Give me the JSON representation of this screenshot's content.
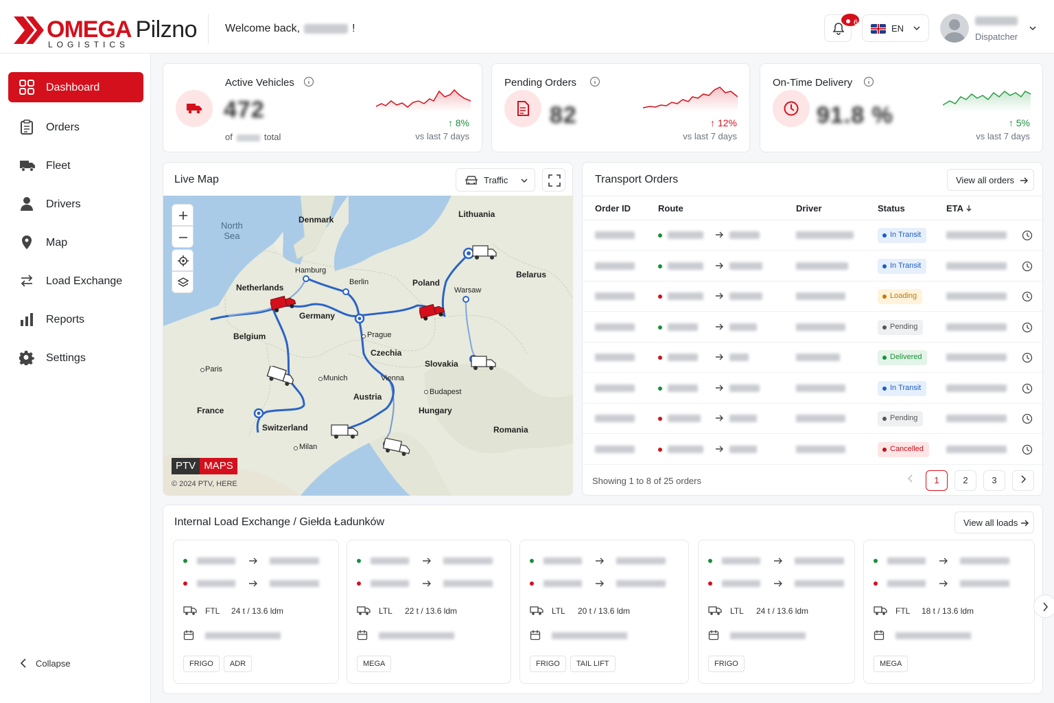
{
  "brand": {
    "name": "OMEGA",
    "city": "Pilzno",
    "tagline": "LOGISTICS"
  },
  "header": {
    "welcome": "Welcome back,",
    "welcome_suffix": "!",
    "notifications_count": "6",
    "language": "EN",
    "user_role": "Dispatcher"
  },
  "sidebar": {
    "items": [
      {
        "label": "Dashboard",
        "icon": "dashboard-icon",
        "active": true
      },
      {
        "label": "Orders",
        "icon": "clipboard-icon"
      },
      {
        "label": "Fleet",
        "icon": "truck-icon"
      },
      {
        "label": "Drivers",
        "icon": "person-icon"
      },
      {
        "label": "Map",
        "icon": "map-pin-icon"
      },
      {
        "label": "Load Exchange",
        "icon": "swap-arrows-icon"
      },
      {
        "label": "Reports",
        "icon": "bar-chart-icon"
      },
      {
        "label": "Settings",
        "icon": "gear-icon"
      }
    ],
    "collapse": "Collapse"
  },
  "kpis": [
    {
      "title": "Active Vehicles",
      "value": "472",
      "of_prefix": "of",
      "of_suffix": "total",
      "change": "8%",
      "change_dir": "up",
      "change_color": "#1a8f3a",
      "vs": "vs last 7 days",
      "accent": "#d4101c"
    },
    {
      "title": "Pending Orders",
      "value": "82",
      "change": "12%",
      "change_dir": "up",
      "change_color": "#d4101c",
      "vs": "vs last 7 days",
      "accent": "#d4101c"
    },
    {
      "title": "On-Time Delivery",
      "value": "91.8 %",
      "change": "5%",
      "change_dir": "up",
      "change_color": "#1a8f3a",
      "vs": "vs last 7 days",
      "accent": "#2a9d45"
    }
  ],
  "map": {
    "title": "Live Map",
    "layer": "Traffic",
    "labels": {
      "north_sea_1": "North",
      "north_sea_2": "Sea",
      "denmark": "Denmark",
      "lithuania": "Lithuania",
      "hamburg": "Hamburg",
      "berlin": "Berlin",
      "poland": "Poland",
      "warsaw": "Warsaw",
      "belarus": "Belarus",
      "netherlands": "Netherlands",
      "germany": "Germany",
      "belgium": "Belgium",
      "prague": "Prague",
      "czechia": "Czechia",
      "slovakia": "Slovakia",
      "paris": "Paris",
      "munich": "Munich",
      "vienna": "Vienna",
      "budapest": "Budapest",
      "austria": "Austria",
      "france": "France",
      "hungary": "Hungary",
      "switzerland": "Switzerland",
      "romania": "Romania",
      "milan": "Milan"
    },
    "provider_a": "PTV",
    "provider_b": "MAPS",
    "copyright": "© 2024 PTV, HERE"
  },
  "orders": {
    "title": "Transport Orders",
    "view_all": "View all orders",
    "columns": [
      "Order ID",
      "Route",
      "Driver",
      "Status",
      "ETA"
    ],
    "rows": [
      {
        "status": "In Transit",
        "status_color": "#1f5fbf",
        "status_bg": "#e6effc",
        "dot": "#1a8f3a"
      },
      {
        "status": "In Transit",
        "status_color": "#1f5fbf",
        "status_bg": "#e6effc",
        "dot": "#1a8f3a"
      },
      {
        "status": "Loading",
        "status_color": "#c27a00",
        "status_bg": "#fff3dc",
        "dot": "#d4101c"
      },
      {
        "status": "Pending",
        "status_color": "#555",
        "status_bg": "#eef0f2",
        "dot": "#1a8f3a"
      },
      {
        "status": "Delivered",
        "status_color": "#1a8f3a",
        "status_bg": "#e3f4e8",
        "dot": "#d4101c"
      },
      {
        "status": "In Transit",
        "status_color": "#1f5fbf",
        "status_bg": "#e6effc",
        "dot": "#1a8f3a"
      },
      {
        "status": "Pending",
        "status_color": "#555",
        "status_bg": "#eef0f2",
        "dot": "#d4101c"
      },
      {
        "status": "Cancelled",
        "status_color": "#c0101a",
        "status_bg": "#fde5e6",
        "dot": "#d4101c"
      }
    ],
    "showing": "Showing 1 to 8 of 25 orders",
    "pages": [
      "1",
      "2",
      "3"
    ]
  },
  "loads": {
    "title": "Internal Load Exchange / Giełda Ładunków",
    "view_all": "View all loads",
    "cards": [
      {
        "type": "FTL",
        "weight": "24 t / 13.6 ldm",
        "tags": [
          "FRIGO",
          "ADR"
        ]
      },
      {
        "type": "LTL",
        "weight": "22 t / 13.6 ldm",
        "tags": [
          "MEGA"
        ]
      },
      {
        "type": "LTL",
        "weight": "20 t / 13.6 ldm",
        "tags": [
          "FRIGO",
          "TAIL LIFT"
        ]
      },
      {
        "type": "LTL",
        "weight": "24 t / 13.6 ldm",
        "tags": [
          "FRIGO"
        ]
      },
      {
        "type": "FTL",
        "weight": "18 t / 13.6 ldm",
        "tags": [
          "MEGA"
        ]
      }
    ]
  },
  "colors": {
    "brand_red": "#d4101c",
    "green": "#1a8f3a",
    "route_blue": "#2b63c6"
  }
}
